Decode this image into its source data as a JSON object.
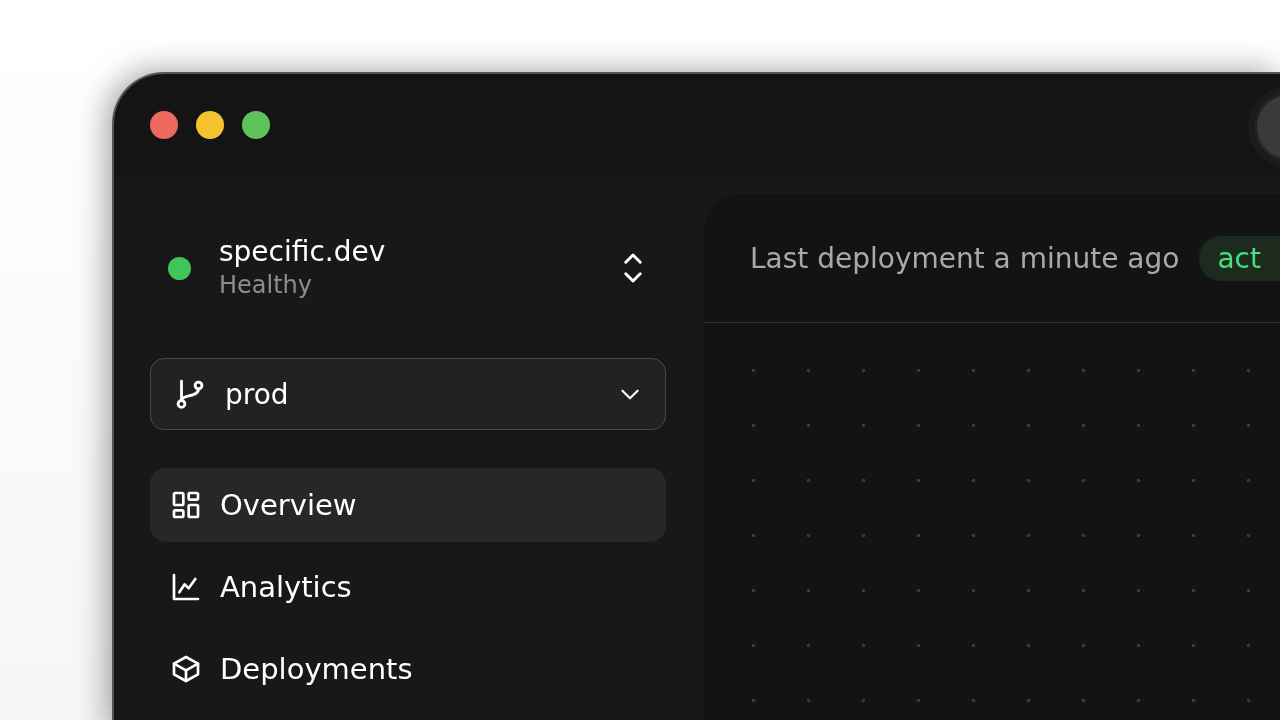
{
  "window": {
    "controls": [
      {
        "color": "#ee6a5f"
      },
      {
        "color": "#f4c430"
      },
      {
        "color": "#5ec45a"
      }
    ]
  },
  "sidebar": {
    "project": {
      "name": "specific.dev",
      "status": "Healthy",
      "color": "#3ec759"
    },
    "branch": {
      "value": "prod"
    },
    "items": [
      {
        "kind": "grid",
        "label": "Overview",
        "selected": true
      },
      {
        "kind": "chart",
        "label": "Analytics",
        "selected": false
      },
      {
        "kind": "cube",
        "label": "Deployments",
        "selected": false
      }
    ]
  },
  "main": {
    "header": {
      "text": "Last deployment a minute ago",
      "badge": "act"
    }
  }
}
